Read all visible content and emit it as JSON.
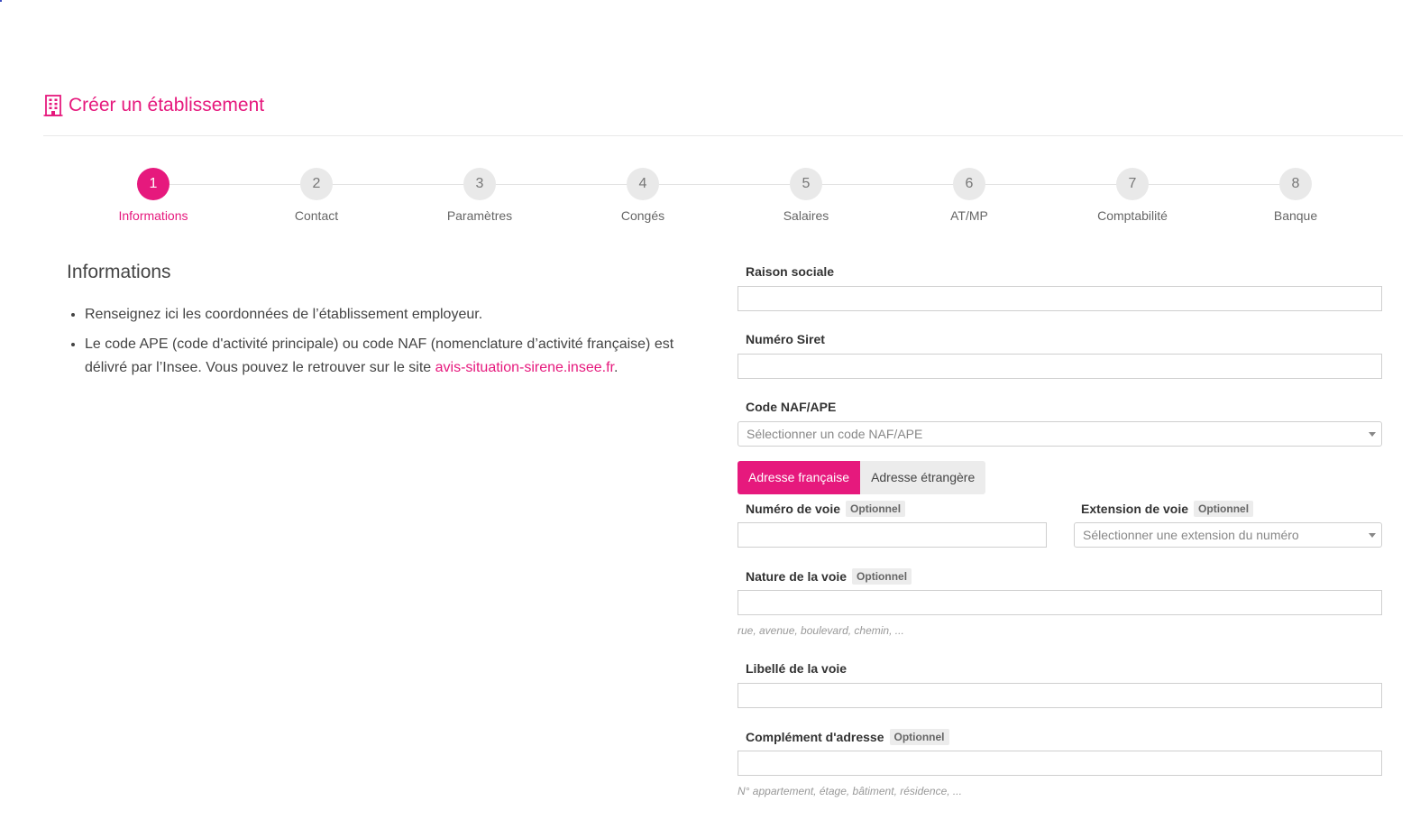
{
  "header": {
    "title": "Créer un établissement",
    "icon": "building-icon",
    "accent": "#e6197d"
  },
  "steps": [
    {
      "number": "1",
      "label": "Informations",
      "active": true
    },
    {
      "number": "2",
      "label": "Contact"
    },
    {
      "number": "3",
      "label": "Paramètres"
    },
    {
      "number": "4",
      "label": "Congés"
    },
    {
      "number": "5",
      "label": "Salaires"
    },
    {
      "number": "6",
      "label": "AT/MP"
    },
    {
      "number": "7",
      "label": "Comptabilité"
    },
    {
      "number": "8",
      "label": "Banque"
    }
  ],
  "info": {
    "heading": "Informations",
    "bullet1": "Renseignez ici les coordonnées de l’établissement employeur.",
    "bullet2_text": "Le code APE (code d'activité principale) ou code NAF (nomenclature d’activité française) est délivré par l’Insee. Vous pouvez le retrouver sur le site ",
    "bullet2_link": "avis-situation-sirene.insee.fr",
    "bullet2_end": "."
  },
  "form": {
    "optional_badge": "Optionnel",
    "raison_sociale": {
      "label": "Raison sociale",
      "value": ""
    },
    "siret": {
      "label": "Numéro Siret",
      "value": ""
    },
    "naf": {
      "label": "Code NAF/APE",
      "placeholder": "Sélectionner un code NAF/APE"
    },
    "address_toggle": {
      "french": "Adresse française",
      "foreign": "Adresse étrangère",
      "selected": "Adresse française"
    },
    "numero_voie": {
      "label": "Numéro de voie",
      "value": ""
    },
    "extension_voie": {
      "label": "Extension de voie",
      "placeholder": "Sélectionner une extension du numéro"
    },
    "nature_voie": {
      "label": "Nature de la voie",
      "help": "rue, avenue, boulevard, chemin, ..."
    },
    "libelle_voie": {
      "label": "Libellé de la voie",
      "value": ""
    },
    "complement": {
      "label": "Complément d'adresse",
      "help": "N° appartement, étage, bâtiment, résidence, ..."
    }
  }
}
